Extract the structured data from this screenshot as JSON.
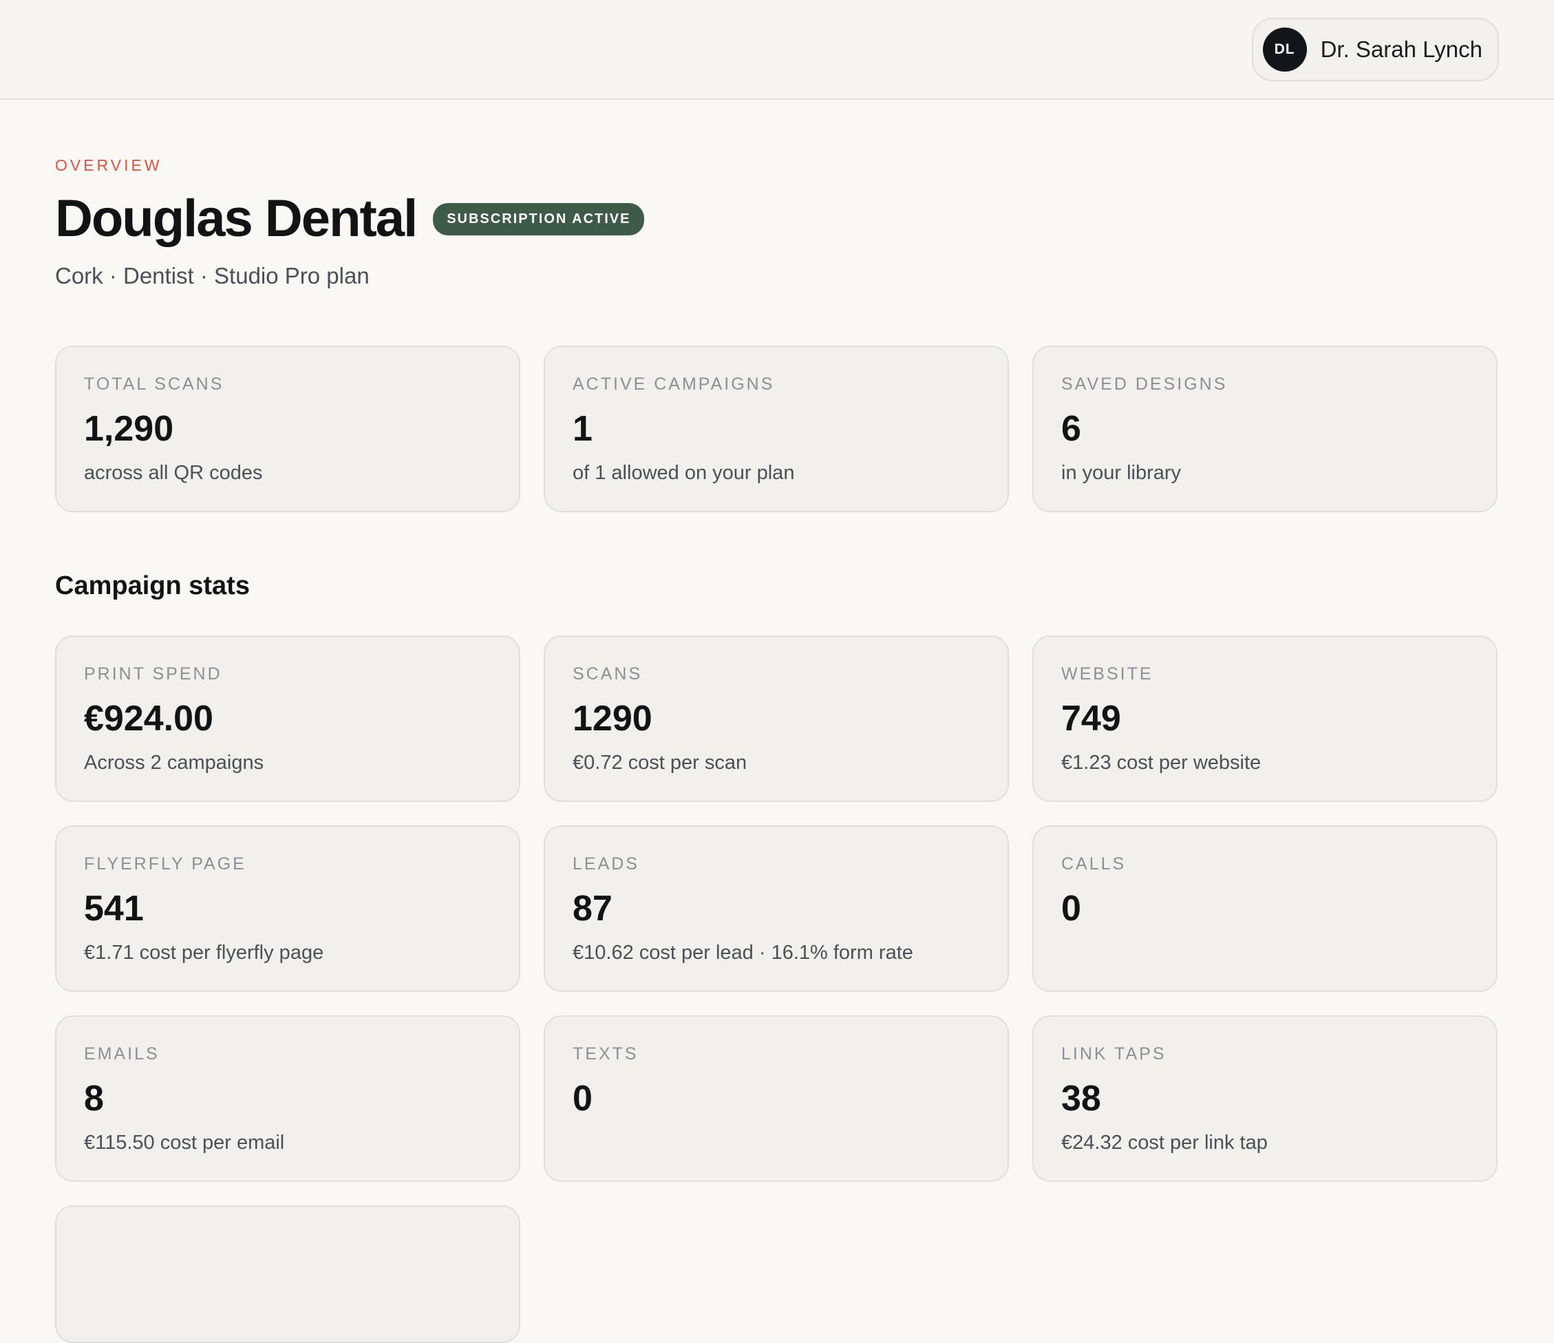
{
  "header": {
    "user": {
      "initials": "DL",
      "name": "Dr. Sarah Lynch"
    }
  },
  "overview": {
    "eyebrow": "OVERVIEW",
    "title": "Douglas Dental",
    "badge": "SUBSCRIPTION ACTIVE",
    "subtitle": "Cork · Dentist · Studio Pro plan"
  },
  "summary_cards": [
    {
      "label": "TOTAL SCANS",
      "value": "1,290",
      "sub": "across all QR codes"
    },
    {
      "label": "ACTIVE CAMPAIGNS",
      "value": "1",
      "sub": "of 1 allowed on your plan"
    },
    {
      "label": "SAVED DESIGNS",
      "value": "6",
      "sub": "in your library"
    }
  ],
  "campaign_stats": {
    "title": "Campaign stats",
    "cards": [
      {
        "label": "PRINT SPEND",
        "value": "€924.00",
        "sub": "Across 2 campaigns"
      },
      {
        "label": "SCANS",
        "value": "1290",
        "sub": "€0.72 cost per scan"
      },
      {
        "label": "WEBSITE",
        "value": "749",
        "sub": "€1.23 cost per website"
      },
      {
        "label": "FLYERFLY PAGE",
        "value": "541",
        "sub": "€1.71 cost per flyerfly page"
      },
      {
        "label": "LEADS",
        "value": "87",
        "sub": "€10.62 cost per lead · 16.1% form rate"
      },
      {
        "label": "CALLS",
        "value": "0",
        "sub": ""
      },
      {
        "label": "EMAILS",
        "value": "8",
        "sub": "€115.50 cost per email"
      },
      {
        "label": "TEXTS",
        "value": "0",
        "sub": ""
      },
      {
        "label": "LINK TAPS",
        "value": "38",
        "sub": "€24.32 cost per link tap"
      }
    ]
  },
  "colors": {
    "accent": "#d8553f",
    "badge": "#3e5a48",
    "background": "#f9f8f5",
    "card": "#f2f0ec"
  }
}
